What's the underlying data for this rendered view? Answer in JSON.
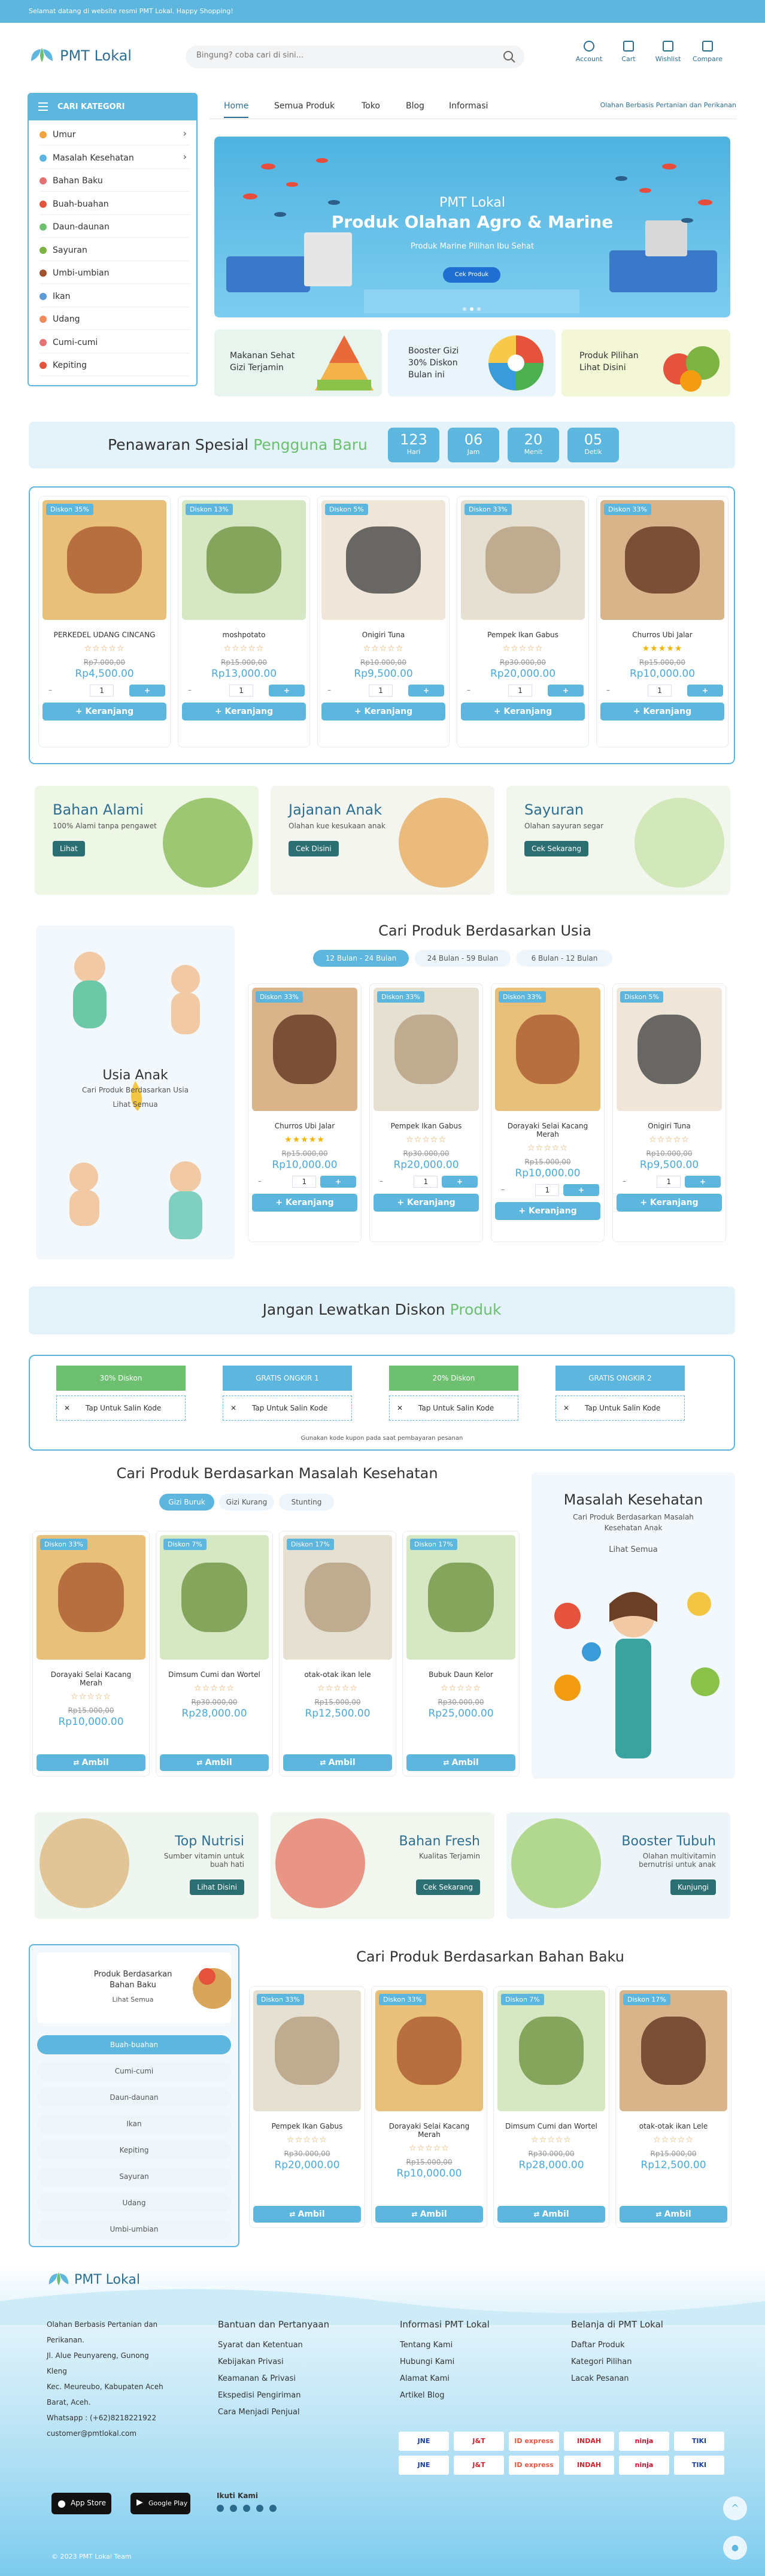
{
  "topbar": {
    "text": "Selamat datang di website resmi PMT Lokal. Happy Shopping!"
  },
  "header": {
    "brand": "PMT Lokal",
    "search_placeholder": "Bingung? coba cari di sini...",
    "actions": [
      {
        "label": "Account",
        "icon": "user-icon"
      },
      {
        "label": "Cart",
        "icon": "cart-icon"
      },
      {
        "label": "Wishlist",
        "icon": "heart-icon"
      },
      {
        "label": "Compare",
        "icon": "compare-icon"
      }
    ]
  },
  "categories": {
    "title": "CARI KATEGORI",
    "items": [
      {
        "label": "Umur",
        "arrow": true
      },
      {
        "label": "Masalah Kesehatan",
        "arrow": true
      },
      {
        "label": "Bahan Baku"
      },
      {
        "label": "Buah-buahan"
      },
      {
        "label": "Daun-daunan"
      },
      {
        "label": "Sayuran"
      },
      {
        "label": "Umbi-umbian"
      },
      {
        "label": "Ikan"
      },
      {
        "label": "Udang"
      },
      {
        "label": "Cumi-cumi"
      },
      {
        "label": "Kepiting"
      }
    ]
  },
  "nav": {
    "items": [
      "Home",
      "Semua Produk",
      "Toko",
      "Blog",
      "Informasi"
    ],
    "tagline": "Olahan Berbasis Pertanian dan Perikanan"
  },
  "hero": {
    "kicker": "PMT Lokal",
    "title": "Produk Olahan Agro & Marine",
    "subtitle": "Produk Marine Pilihan Ibu Sehat",
    "cta": "Cek Produk"
  },
  "mini_banners": [
    {
      "text": "Makanan Sehat Gizi Terjamin"
    },
    {
      "text": "Booster Gizi 30% Diskon Bulan ini"
    },
    {
      "text": "Produk Pilihan Lihat Disini"
    }
  ],
  "flash": {
    "title_a": "Penawaran Spesial ",
    "title_b": "Pengguna Baru",
    "countdown": [
      {
        "v": "123",
        "u": "Hari"
      },
      {
        "v": "06",
        "u": "Jam"
      },
      {
        "v": "20",
        "u": "Menit"
      },
      {
        "v": "05",
        "u": "Detik"
      }
    ]
  },
  "flash_products": [
    {
      "badge": "Diskon 35%",
      "name": "PERKEDEL UDANG CINCANG",
      "stars": "☆☆☆☆☆",
      "old": "Rp7.000,00",
      "price": "Rp4,500.00",
      "qty": "1",
      "cart": "+ Keranjang"
    },
    {
      "badge": "Diskon 13%",
      "name": "moshpotato",
      "stars": "☆☆☆☆☆",
      "old": "Rp15.000,00",
      "price": "Rp13,000.00",
      "qty": "1",
      "cart": "+ Keranjang"
    },
    {
      "badge": "Diskon 5%",
      "name": "Onigiri Tuna",
      "stars": "☆☆☆☆☆",
      "old": "Rp10.000,00",
      "price": "Rp9,500.00",
      "qty": "1",
      "cart": "+ Keranjang"
    },
    {
      "badge": "Diskon 33%",
      "name": "Pempek Ikan Gabus",
      "stars": "☆☆☆☆☆",
      "old": "Rp30.000,00",
      "price": "Rp20,000.00",
      "qty": "1",
      "cart": "+ Keranjang"
    },
    {
      "badge": "Diskon 33%",
      "name": "Churros Ubi Jalar",
      "stars": "★★★★★",
      "old": "Rp15.000,00",
      "price": "Rp10,000.00",
      "qty": "1",
      "cart": "+ Keranjang"
    }
  ],
  "cat_banners": [
    {
      "title": "Bahan Alami",
      "sub": "100% Alami tanpa pengawet",
      "btn": "Lihat"
    },
    {
      "title": "Jajanan Anak",
      "sub": "Olahan kue kesukaan anak",
      "btn": "Cek Disini"
    },
    {
      "title": "Sayuran",
      "sub": "Olahan sayuran segar",
      "btn": "Cek Sekarang"
    }
  ],
  "age": {
    "title": "Cari Produk Berdasarkan Usia",
    "tabs": [
      "12 Bulan - 24 Bulan",
      "24 Bulan - 59 Bulan",
      "6 Bulan - 12 Bulan"
    ],
    "side_title": "Usia Anak",
    "side_sub": "Cari Produk Berdasarkan Usia",
    "side_link": "Lihat Semua"
  },
  "age_products": [
    {
      "badge": "Diskon 33%",
      "name": "Churros Ubi Jalar",
      "stars": "★★★★★",
      "old": "Rp15.000,00",
      "price": "Rp10,000.00",
      "qty": "1",
      "cart": "+ Keranjang"
    },
    {
      "badge": "Diskon 33%",
      "name": "Pempek Ikan Gabus",
      "stars": "☆☆☆☆☆",
      "old": "Rp30.000,00",
      "price": "Rp20,000.00",
      "qty": "1",
      "cart": "+ Keranjang"
    },
    {
      "badge": "Diskon 33%",
      "name": "Dorayaki Selai Kacang Merah",
      "stars": "☆☆☆☆☆",
      "old": "Rp15.000,00",
      "price": "Rp10,000.00",
      "qty": "1",
      "cart": "+ Keranjang"
    },
    {
      "badge": "Diskon 5%",
      "name": "Onigiri Tuna",
      "stars": "☆☆☆☆☆",
      "old": "Rp10.000,00",
      "price": "Rp9,500.00",
      "qty": "1",
      "cart": "+ Keranjang"
    }
  ],
  "coupon": {
    "title_a": "Jangan Lewatkan Diskon ",
    "title_b": "Produk",
    "items": [
      {
        "label": "30% Diskon",
        "code": "Tap Untuk Salin Kode",
        "color": "#6dc06f"
      },
      {
        "label": "GRATIS ONGKIR 1",
        "code": "Tap Untuk Salin Kode",
        "color": "#5cb6de"
      },
      {
        "label": "20% Diskon",
        "code": "Tap Untuk Salin Kode",
        "color": "#6dc06f"
      },
      {
        "label": "GRATIS ONGKIR 2",
        "code": "Tap Untuk Salin Kode",
        "color": "#5cb6de"
      }
    ],
    "note": "Gunakan kode kupon pada saat pembayaran pesanan"
  },
  "health": {
    "title": "Cari Produk Berdasarkan Masalah Kesehatan",
    "tabs": [
      "Gizi Buruk",
      "Gizi Kurang",
      "Stunting"
    ],
    "side_title": "Masalah Kesehatan",
    "side_sub": "Cari Produk Berdasarkan Masalah Kesehatan Anak",
    "side_link": "Lihat Semua"
  },
  "health_products": [
    {
      "badge": "Diskon 33%",
      "name": "Dorayaki Selai Kacang Merah",
      "stars": "☆☆☆☆☆",
      "old": "Rp15.000,00",
      "price": "Rp10,000.00",
      "btn": "Ambil"
    },
    {
      "badge": "Diskon 7%",
      "name": "Dimsum Cumi dan Wortel",
      "stars": "☆☆☆☆☆",
      "old": "Rp30.000,00",
      "price": "Rp28,000.00",
      "btn": "Ambil"
    },
    {
      "badge": "Diskon 17%",
      "name": "otak-otak ikan lele",
      "stars": "☆☆☆☆☆",
      "old": "Rp15.000,00",
      "price": "Rp12,500.00",
      "btn": "Ambil"
    },
    {
      "badge": "Diskon 17%",
      "name": "Bubuk Daun Kelor",
      "stars": "☆☆☆☆☆",
      "old": "Rp30.000,00",
      "price": "Rp25,000.00",
      "btn": "Ambil"
    }
  ],
  "promo3": [
    {
      "title": "Top Nutrisi",
      "sub": "Sumber vitamin untuk buah hati",
      "btn": "Lihat Disini"
    },
    {
      "title": "Bahan Fresh",
      "sub": "Kualitas Terjamin",
      "btn": "Cek Sekarang"
    },
    {
      "title": "Booster Tubuh",
      "sub": "Olahan multivitamin bernutrisi untuk anak",
      "btn": "Kunjungi"
    }
  ],
  "raw": {
    "title": "Cari Produk Berdasarkan Bahan Baku",
    "side_title": "Produk Berdasarkan Bahan Baku",
    "side_link": "Lihat Semua",
    "tabs": [
      "Buah-buahan",
      "Cumi-cumi",
      "Daun-daunan",
      "Ikan",
      "Kepiting",
      "Sayuran",
      "Udang",
      "Umbi-umbian"
    ]
  },
  "raw_products": [
    {
      "badge": "Diskon 33%",
      "name": "Pempek Ikan Gabus",
      "stars": "☆☆☆☆☆",
      "old": "Rp30.000,00",
      "price": "Rp20,000.00",
      "btn": "Ambil"
    },
    {
      "badge": "Diskon 33%",
      "name": "Dorayaki Selai Kacang Merah",
      "stars": "☆☆☆☆☆",
      "old": "Rp15.000,00",
      "price": "Rp10,000.00",
      "btn": "Ambil"
    },
    {
      "badge": "Diskon 7%",
      "name": "Dimsum Cumi dan Wortel",
      "stars": "☆☆☆☆☆",
      "old": "Rp30.000,00",
      "price": "Rp28,000.00",
      "btn": "Ambil"
    },
    {
      "badge": "Diskon 17%",
      "name": "otak-otak ikan Lele",
      "stars": "☆☆☆☆☆",
      "old": "Rp15.000,00",
      "price": "Rp12,500.00",
      "btn": "Ambil"
    }
  ],
  "footer": {
    "brand": "PMT Lokal",
    "about": [
      "Olahan Berbasis Pertanian dan",
      "Perikanan.",
      "Jl. Alue Peunyareng, Gunong",
      "Kleng",
      "Kec. Meureubo, Kabupaten Aceh",
      "Barat, Aceh.",
      "Whatsapp : (+62)8218221922",
      "customer@pmtlokal.com"
    ],
    "col2": {
      "title": "Bantuan dan Pertanyaan",
      "links": [
        "Syarat dan Ketentuan",
        "Kebijakan Privasi",
        "Keamanan & Privasi",
        "Ekspedisi Pengiriman",
        "Cara Menjadi Penjual"
      ]
    },
    "col3": {
      "title": "Informasi PMT Lokal",
      "links": [
        "Tentang Kami",
        "Hubungi Kami",
        "Alamat Kami",
        "Artikel Blog"
      ]
    },
    "col4": {
      "title": "Belanja di PMT Lokal",
      "links": [
        "Daftar Produk",
        "Kategori Pilihan",
        "Lacak Pesanan"
      ]
    },
    "couriers": [
      "JNE",
      "J&T",
      "ID express",
      "INDAH",
      "ninja",
      "TIKI",
      "JNE",
      "J&T",
      "ID express",
      "INDAH",
      "ninja",
      "TIKI"
    ],
    "appstore": "App Store",
    "googleplay": "Google Play",
    "follow": "Ikuti Kami",
    "copyright": "© 2023 PMT Lokal Team"
  }
}
